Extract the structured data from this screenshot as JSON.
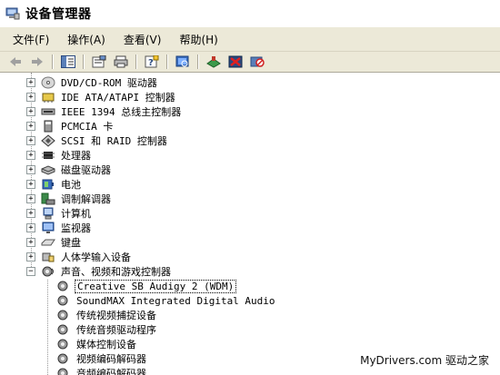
{
  "window": {
    "title": "设备管理器"
  },
  "menu": [
    {
      "label": "文件(F)"
    },
    {
      "label": "操作(A)"
    },
    {
      "label": "查看(V)"
    },
    {
      "label": "帮助(H)"
    }
  ],
  "tree": {
    "categories": [
      {
        "label": "DVD/CD-ROM 驱动器",
        "icon": "cdrom-icon"
      },
      {
        "label": "IDE ATA/ATAPI 控制器",
        "icon": "ide-controller-icon"
      },
      {
        "label": "IEEE 1394 总线主控制器",
        "icon": "ieee1394-icon"
      },
      {
        "label": "PCMCIA 卡",
        "icon": "pcmcia-icon"
      },
      {
        "label": "SCSI 和 RAID 控制器",
        "icon": "scsi-icon"
      },
      {
        "label": "处理器",
        "icon": "processor-icon"
      },
      {
        "label": "磁盘驱动器",
        "icon": "disk-drive-icon"
      },
      {
        "label": "电池",
        "icon": "battery-icon"
      },
      {
        "label": "调制解调器",
        "icon": "modem-icon"
      },
      {
        "label": "计算机",
        "icon": "computer-icon"
      },
      {
        "label": "监视器",
        "icon": "monitor-icon"
      },
      {
        "label": "键盘",
        "icon": "keyboard-icon"
      },
      {
        "label": "人体学输入设备",
        "icon": "hid-icon"
      },
      {
        "label": "声音、视频和游戏控制器",
        "icon": "sound-icon",
        "expanded": true
      }
    ],
    "sound_devices": [
      {
        "label": "Creative SB Audigy 2 (WDM)",
        "selected": true
      },
      {
        "label": "SoundMAX Integrated Digital Audio"
      },
      {
        "label": "传统视频捕捉设备"
      },
      {
        "label": "传统音频驱动程序"
      },
      {
        "label": "媒体控制设备"
      },
      {
        "label": "视频编码解码器"
      },
      {
        "label": "音频编码解码器"
      }
    ]
  },
  "watermark": "MyDrivers.com 驱动之家"
}
